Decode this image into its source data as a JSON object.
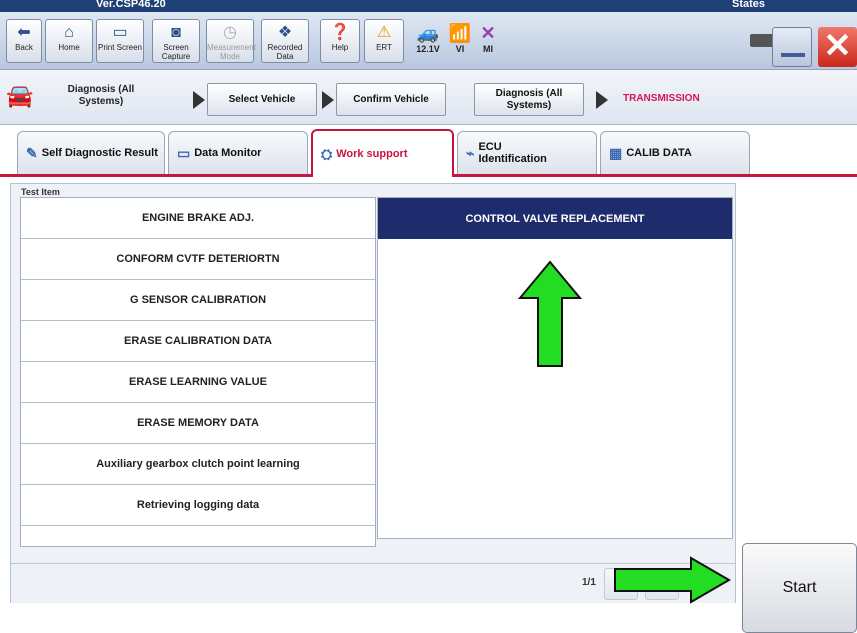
{
  "titlebar": {
    "version": "Ver.CSP46.20",
    "states": "States"
  },
  "toolbar": {
    "buttons": [
      {
        "label": "Back",
        "icon": "back-arrow-icon"
      },
      {
        "label": "Home",
        "icon": "home-icon"
      },
      {
        "label": "Print Screen",
        "icon": "printer-icon"
      },
      {
        "label": "Screen Capture",
        "icon": "camera-icon"
      },
      {
        "label": "Measurement Mode",
        "icon": "meter-icon"
      },
      {
        "label": "Recorded Data",
        "icon": "recorded-data-icon"
      },
      {
        "label": "Help",
        "icon": "help-icon"
      },
      {
        "label": "ERT",
        "icon": "warning-icon"
      }
    ],
    "status": {
      "voltage": "12.1V",
      "vi": "VI",
      "mi": "MI"
    }
  },
  "breadcrumb": {
    "context": "Diagnosis (All Systems)",
    "steps": [
      "Select Vehicle",
      "Confirm Vehicle",
      "Diagnosis (All Systems)"
    ],
    "current": "TRANSMISSION"
  },
  "tabs": [
    {
      "label": "Self Diagnostic Result"
    },
    {
      "label": "Data Monitor"
    },
    {
      "label": "Work support"
    },
    {
      "label": "ECU Identification"
    },
    {
      "label": "CALIB DATA"
    }
  ],
  "panel": {
    "header": "Test Item",
    "items": [
      "ENGINE BRAKE ADJ.",
      "CONFORM CVTF DETERIORTN",
      "G SENSOR CALIBRATION",
      "ERASE CALIBRATION DATA",
      "ERASE LEARNING VALUE",
      "ERASE MEMORY DATA",
      "Auxiliary gearbox clutch point learning",
      "Retrieving logging data"
    ],
    "selected_item": "CONTROL VALVE REPLACEMENT",
    "page": "1/1"
  },
  "start_label": "Start",
  "colors": {
    "accent": "#c9143f",
    "selected": "#1e2b6d",
    "arrow": "#22dd22"
  }
}
